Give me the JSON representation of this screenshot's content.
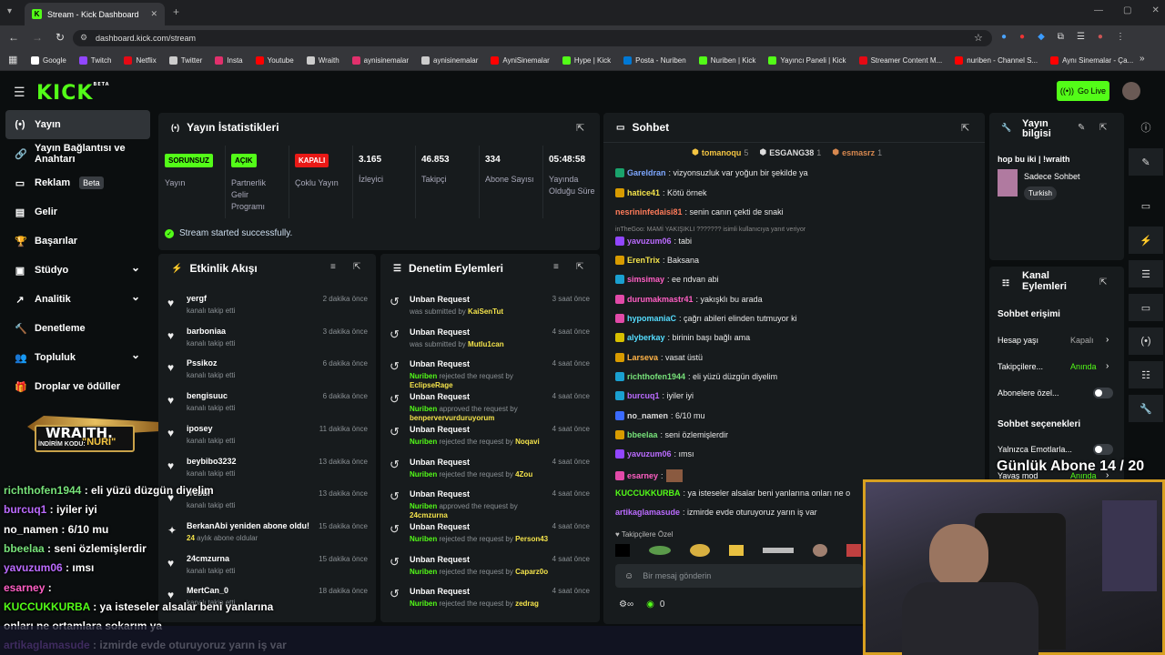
{
  "browser": {
    "tab_title": "Stream - Kick Dashboard",
    "url": "dashboard.kick.com/stream",
    "bookmarks": [
      {
        "label": "Google",
        "color": "#ffffff"
      },
      {
        "label": "Twitch",
        "color": "#9146ff"
      },
      {
        "label": "Netflix",
        "color": "#e50914"
      },
      {
        "label": "Twitter",
        "color": "#cccccc"
      },
      {
        "label": "Insta",
        "color": "#e1306c"
      },
      {
        "label": "Youtube",
        "color": "#ff0000"
      },
      {
        "label": "Wraith",
        "color": "#cccccc"
      },
      {
        "label": "aynisinemalar",
        "color": "#e1306c"
      },
      {
        "label": "aynisinemalar",
        "color": "#cccccc"
      },
      {
        "label": "AyniSinemalar",
        "color": "#ff0000"
      },
      {
        "label": "Hype | Kick",
        "color": "#53fc18"
      },
      {
        "label": "Posta - Nuriben",
        "color": "#0078d4"
      },
      {
        "label": "Nuriben | Kick",
        "color": "#53fc18"
      },
      {
        "label": "Yayıncı Paneli | Kick",
        "color": "#53fc18"
      },
      {
        "label": "Streamer Content M...",
        "color": "#e50914"
      },
      {
        "label": "nuriben - Channel S...",
        "color": "#ff0000"
      },
      {
        "label": "Aynı Sinemalar - Ça...",
        "color": "#ff0000"
      }
    ]
  },
  "header": {
    "logo": "KICK",
    "logo_sup": "BETA",
    "go_live": "Go Live"
  },
  "sidebar": [
    {
      "label": "Yayın",
      "icon": "broadcast-icon",
      "glyph": "(•)"
    },
    {
      "label": "Yayın Bağlantısı ve Anahtarı",
      "icon": "link-icon",
      "glyph": "🔗"
    },
    {
      "label": "Reklam",
      "icon": "ad-icon",
      "glyph": "▭",
      "badge": "Beta"
    },
    {
      "label": "Gelir",
      "icon": "revenue-icon",
      "glyph": "▤"
    },
    {
      "label": "Başarılar",
      "icon": "trophy-icon",
      "glyph": "🏆"
    },
    {
      "label": "Stüdyo",
      "icon": "studio-icon",
      "glyph": "▣",
      "chevron": "⌄"
    },
    {
      "label": "Analitik",
      "icon": "analytics-icon",
      "glyph": "↗",
      "chevron": "⌄"
    },
    {
      "label": "Denetleme",
      "icon": "moderation-icon",
      "glyph": "🔨"
    },
    {
      "label": "Topluluk",
      "icon": "community-icon",
      "glyph": "👥",
      "chevron": "⌄"
    },
    {
      "label": "Droplar ve ödüller",
      "icon": "drops-icon",
      "glyph": "🎁"
    }
  ],
  "promo": {
    "brand": "WRAITH.",
    "code_label": "İNDİRİM KODU:",
    "code": "\"NURI\""
  },
  "stats": {
    "title": "Yayın İstatistikleri",
    "cols": [
      {
        "badge": "SORUNSUZ",
        "badge_color": "#53fc18",
        "label": "Yayın"
      },
      {
        "badge": "AÇIK",
        "badge_color": "#53fc18",
        "label": "Partnerlik Gelir Programı"
      },
      {
        "badge": "KAPALI",
        "badge_color": "#e91916",
        "label": "Çoklu Yayın"
      },
      {
        "value": "3.165",
        "label": "İzleyici"
      },
      {
        "value": "46.853",
        "label": "Takipçi"
      },
      {
        "value": "334",
        "label": "Abone Sayısı"
      },
      {
        "value": "05:48:58",
        "label": "Yayında Olduğu Süre"
      }
    ],
    "success": "Stream started successfully."
  },
  "activity": {
    "title": "Etkinlik Akışı",
    "items": [
      {
        "name": "yergf",
        "sub": "kanalı takip etti",
        "time": "2 dakika önce",
        "icon": "heart"
      },
      {
        "name": "barboniaa",
        "sub": "kanalı takip etti",
        "time": "3 dakika önce",
        "icon": "heart"
      },
      {
        "name": "Pssikoz",
        "sub": "kanalı takip etti",
        "time": "6 dakika önce",
        "icon": "heart"
      },
      {
        "name": "bengisuuc",
        "sub": "kanalı takip etti",
        "time": "6 dakika önce",
        "icon": "heart"
      },
      {
        "name": "iposey",
        "sub": "kanalı takip etti",
        "time": "11 dakika önce",
        "icon": "heart"
      },
      {
        "name": "beybibo3232",
        "sub": "kanalı takip etti",
        "time": "13 dakika önce",
        "icon": "heart"
      },
      {
        "name": "rrebbr",
        "sub": "kanalı takip etti",
        "time": "13 dakika önce",
        "icon": "heart"
      },
      {
        "name": "BerkanAbi yeniden abone oldu!",
        "sub_num": "24",
        "sub": "aylık abone oldular",
        "time": "15 dakika önce",
        "icon": "star"
      },
      {
        "name": "24cmzurna",
        "sub": "kanalı takip etti",
        "time": "15 dakika önce",
        "icon": "heart"
      },
      {
        "name": "MertCan_0",
        "sub": "kanalı takip etti",
        "time": "18 dakika önce",
        "icon": "heart"
      }
    ]
  },
  "moderation": {
    "title": "Denetim Eylemleri",
    "items": [
      {
        "title": "Unban Request",
        "who": "",
        "text": "was submitted by",
        "target": "KaiSenTut",
        "time": "3 saat önce"
      },
      {
        "title": "Unban Request",
        "who": "",
        "text": "was submitted by",
        "target": "Mutlu1can",
        "time": "4 saat önce"
      },
      {
        "title": "Unban Request",
        "who": "Nuriben",
        "text": "rejected the request by",
        "target": "EclipseRage",
        "time": "4 saat önce"
      },
      {
        "title": "Unban Request",
        "who": "Nuriben",
        "text": "approved the request by",
        "target": "benpervervurduruyorum",
        "time": "4 saat önce"
      },
      {
        "title": "Unban Request",
        "who": "Nuriben",
        "text": "rejected the request by",
        "target": "Noqavi",
        "time": "4 saat önce"
      },
      {
        "title": "Unban Request",
        "who": "Nuriben",
        "text": "rejected the request by",
        "target": "4Zou",
        "time": "4 saat önce"
      },
      {
        "title": "Unban Request",
        "who": "Nuriben",
        "text": "approved the request by",
        "target": "24cmzurna",
        "time": "4 saat önce"
      },
      {
        "title": "Unban Request",
        "who": "Nuriben",
        "text": "rejected the request by",
        "target": "Person43",
        "time": "4 saat önce"
      },
      {
        "title": "Unban Request",
        "who": "Nuriben",
        "text": "rejected the request by",
        "target": "Caparz0o",
        "time": "4 saat önce"
      },
      {
        "title": "Unban Request",
        "who": "Nuriben",
        "text": "rejected the request by",
        "target": "zedrag",
        "time": "4 saat önce"
      }
    ]
  },
  "chat": {
    "title": "Sohbet",
    "top_gifters": [
      {
        "name": "tomanoqu",
        "count": "5",
        "color": "#f5c542"
      },
      {
        "name": "ESGANG38",
        "count": "1",
        "color": "#dddddd"
      },
      {
        "name": "esmasrz",
        "count": "1",
        "color": "#d7884f"
      }
    ],
    "reply_note": "inTheGoo: MAMİ YAKIŞIKLI ??????? isimli kullanıcıya yanıt veriyor",
    "messages": [
      {
        "user": "Gareldran",
        "color": "#7da7ff",
        "text": ": vizyonsuzluk var yoğun bir şekilde ya",
        "badge_color": "#1aa36c"
      },
      {
        "user": "hatice41",
        "color": "#f5e44b",
        "text": ": Kötü örnek",
        "badge_color": "#d89b00"
      },
      {
        "user": "nesrininfedaisi81",
        "color": "#ff7b5a",
        "text": ": senin canın çekti de snaki",
        "badge_color": ""
      },
      {
        "user": "yavuzum06",
        "color": "#bb6bff",
        "text": ": tabi",
        "badge_color": "#9146ff"
      },
      {
        "user": "ErenTrix",
        "color": "#f5e44b",
        "text": ": Baksana",
        "badge_color": "#d89b00"
      },
      {
        "user": "simsimay",
        "color": "#ff5fc4",
        "text": ": ee ndvan abi",
        "badge_color": "#1aa0d0"
      },
      {
        "user": "durumakmastr41",
        "color": "#ff5fc4",
        "text": ": yakışklı bu arada",
        "badge_color": "#e24aa8"
      },
      {
        "user": "hypomaniaC",
        "color": "#55ddff",
        "text": ": çağrı abileri elinden tutmuyor ki",
        "badge_color": "#e24aa8"
      },
      {
        "user": "alyberkay",
        "color": "#55ddff",
        "text": ": birinin başı bağlı ama",
        "badge_color": "#d8c000"
      },
      {
        "user": "Larseva",
        "color": "#ffb347",
        "text": ": vasat üstü",
        "badge_color": "#d89b00"
      },
      {
        "user": "richthofen1944",
        "color": "#77e27a",
        "text": ": eli yüzü düzgün diyelim",
        "badge_color": "#1aa0d0"
      },
      {
        "user": "burcuq1",
        "color": "#bb6bff",
        "text": ": iyiler iyi",
        "badge_color": "#1aa0d0"
      },
      {
        "user": "no_namen",
        "color": "#dddddd",
        "text": ": 6/10 mu",
        "badge_color": "#3b6bff"
      },
      {
        "user": "bbeelaa",
        "color": "#77e27a",
        "text": ": seni özlemişlerdir",
        "badge_color": "#d89b00"
      },
      {
        "user": "yavuzum06",
        "color": "#bb6bff",
        "text": ": ımsı",
        "badge_color": "#9146ff"
      },
      {
        "user": "esarney",
        "color": "#ff5fc4",
        "text": ":",
        "badge_color": "#e24aa8"
      },
      {
        "user": "KUCCUKKURBA",
        "color": "#53fc18",
        "text": ": ya isteseler alsalar beni yanlarına onları ne o",
        "badge_color": ""
      },
      {
        "user": "artikaglamasude",
        "color": "#bb6bff",
        "text": ": izmirde evde oturuyoruz yarın iş var",
        "badge_color": ""
      }
    ],
    "emote_label": "Takipçilere Özel",
    "input_placeholder": "Bir mesaj gönderin",
    "points": "0"
  },
  "stream_info": {
    "title": "Yayın bilgisi",
    "stream_title": "hop bu iki | !wraith",
    "category": "Sadece Sohbet",
    "tag": "Turkish"
  },
  "channel_actions": {
    "title": "Kanal Eylemleri",
    "section1": "Sohbet erişimi",
    "rows": [
      {
        "label": "Hesap yaşı",
        "value": "Kapalı"
      },
      {
        "label": "Takipçilere...",
        "value": "Anında"
      },
      {
        "label": "Abonelere özel...",
        "value": ""
      }
    ],
    "section2": "Sohbet seçenekleri",
    "rows2": [
      {
        "label": "Yalnızca Emotlarla...",
        "value": ""
      },
      {
        "label": "Yavaş mod",
        "value": "Anında"
      }
    ]
  },
  "overlay": {
    "daily_sub": "Günlük Abone 14 / 20",
    "chat": [
      {
        "user": "richthofen1944",
        "color": "#77e27a",
        "text": " : eli yüzü düzgün diyelim"
      },
      {
        "user": "burcuq1",
        "color": "#bb6bff",
        "text": " : iyiler iyi"
      },
      {
        "user": "no_namen",
        "color": "#ffffff",
        "text": " : 6/10 mu"
      },
      {
        "user": "bbeelaa",
        "color": "#77e27a",
        "text": " : seni özlemişlerdir"
      },
      {
        "user": "yavuzum06",
        "color": "#bb6bff",
        "text": " : ımsı"
      },
      {
        "user": "esarney",
        "color": "#ff5fc4",
        "text": " :"
      },
      {
        "user": "KUCCUKKURBA",
        "color": "#53fc18",
        "text": " : ya isteseler alsalar beni yanlarına"
      },
      {
        "user": "",
        "color": "#ffffff",
        "text": "onları ne ortamlara sokarım ya"
      },
      {
        "user": "artikaglamasude",
        "color": "#bb6bff",
        "text": " : izmirde evde oturuyoruz yarın iş var"
      }
    ]
  }
}
